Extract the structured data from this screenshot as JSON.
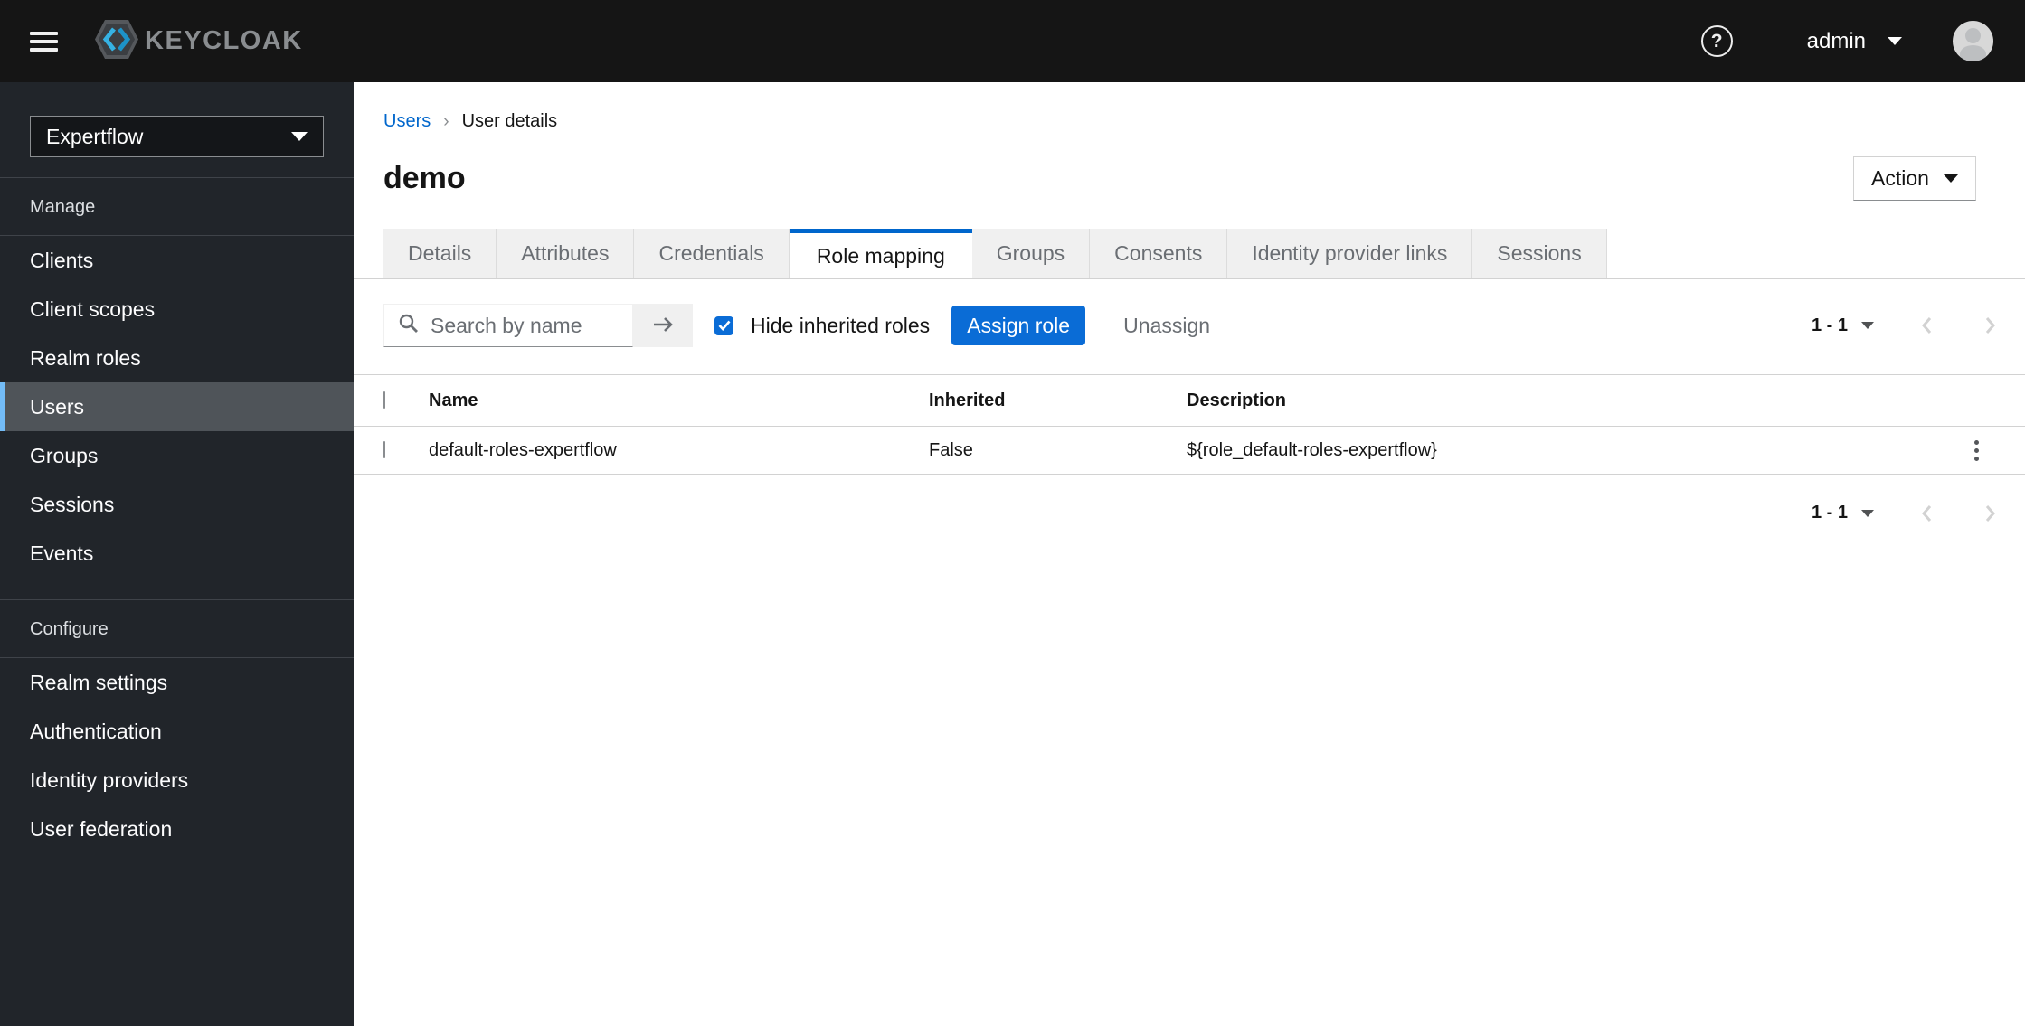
{
  "topbar": {
    "brand": "KEYCLOAK",
    "username": "admin"
  },
  "sidebar": {
    "realm": "Expertflow",
    "sections": [
      {
        "label": "Manage",
        "items": [
          {
            "label": "Clients",
            "active": false
          },
          {
            "label": "Client scopes",
            "active": false
          },
          {
            "label": "Realm roles",
            "active": false
          },
          {
            "label": "Users",
            "active": true
          },
          {
            "label": "Groups",
            "active": false
          },
          {
            "label": "Sessions",
            "active": false
          },
          {
            "label": "Events",
            "active": false
          }
        ]
      },
      {
        "label": "Configure",
        "items": [
          {
            "label": "Realm settings",
            "active": false
          },
          {
            "label": "Authentication",
            "active": false
          },
          {
            "label": "Identity providers",
            "active": false
          },
          {
            "label": "User federation",
            "active": false
          }
        ]
      }
    ]
  },
  "breadcrumb": {
    "parent": "Users",
    "current": "User details"
  },
  "page": {
    "title": "demo",
    "action_label": "Action"
  },
  "tabs": [
    {
      "label": "Details",
      "active": false
    },
    {
      "label": "Attributes",
      "active": false
    },
    {
      "label": "Credentials",
      "active": false
    },
    {
      "label": "Role mapping",
      "active": true
    },
    {
      "label": "Groups",
      "active": false
    },
    {
      "label": "Consents",
      "active": false
    },
    {
      "label": "Identity provider links",
      "active": false
    },
    {
      "label": "Sessions",
      "active": false
    }
  ],
  "toolbar": {
    "search_placeholder": "Search by name",
    "hide_inherited_label": "Hide inherited roles",
    "hide_inherited_checked": true,
    "assign_label": "Assign role",
    "unassign_label": "Unassign",
    "pagination_range": "1 - 1"
  },
  "table": {
    "columns": {
      "name": "Name",
      "inherited": "Inherited",
      "description": "Description"
    },
    "rows": [
      {
        "name": "default-roles-expertflow",
        "inherited": "False",
        "description": "${role_default-roles-expertflow}",
        "selected": false
      }
    ]
  },
  "pagination_bottom": {
    "range": "1 - 1"
  },
  "colors": {
    "accent": "#0a6cd6",
    "link": "#0066cc",
    "masthead_bg": "#151515",
    "sidebar_bg": "#21252a",
    "nav_selected_bg": "#4f5459",
    "nav_selected_border": "#73bcf7"
  }
}
